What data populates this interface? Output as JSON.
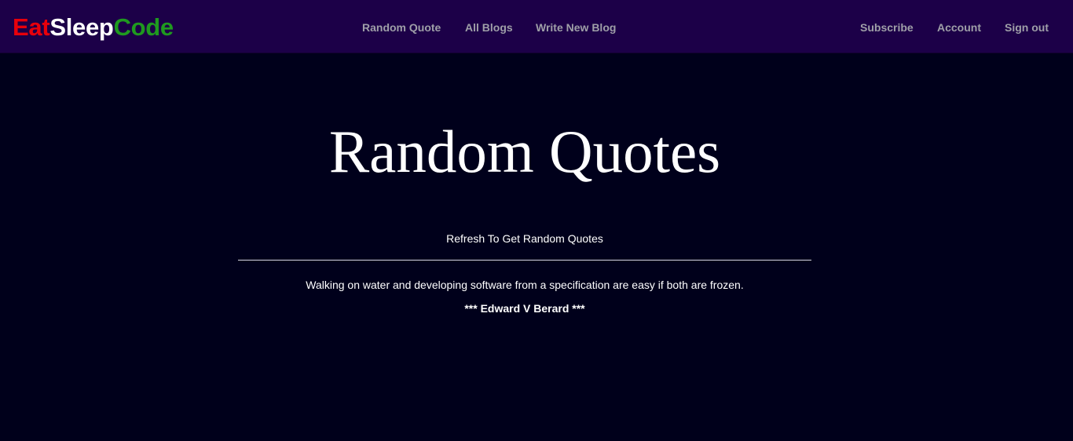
{
  "brand": {
    "part1": "Eat",
    "part2": "Sleep",
    "part3": "Code",
    "colors": {
      "part1": "#e8000b",
      "part2": "#ffffff",
      "part3": "#1f9a1f"
    }
  },
  "nav": {
    "left": [
      {
        "label": "Random Quote"
      },
      {
        "label": "All Blogs"
      },
      {
        "label": "Write New Blog"
      }
    ],
    "right": [
      {
        "label": "Subscribe"
      },
      {
        "label": "Account"
      },
      {
        "label": "Sign out"
      }
    ]
  },
  "main": {
    "title": "Random Quotes",
    "subtitle": "Refresh To Get Random Quotes",
    "quote": "Walking on water and developing software from a specification are easy if both are frozen.",
    "author": "*** Edward V Berard ***"
  },
  "theme": {
    "page_background": "#00001b",
    "navbar_background": "#1c0048",
    "nav_link_color": "#9f9fa8"
  }
}
